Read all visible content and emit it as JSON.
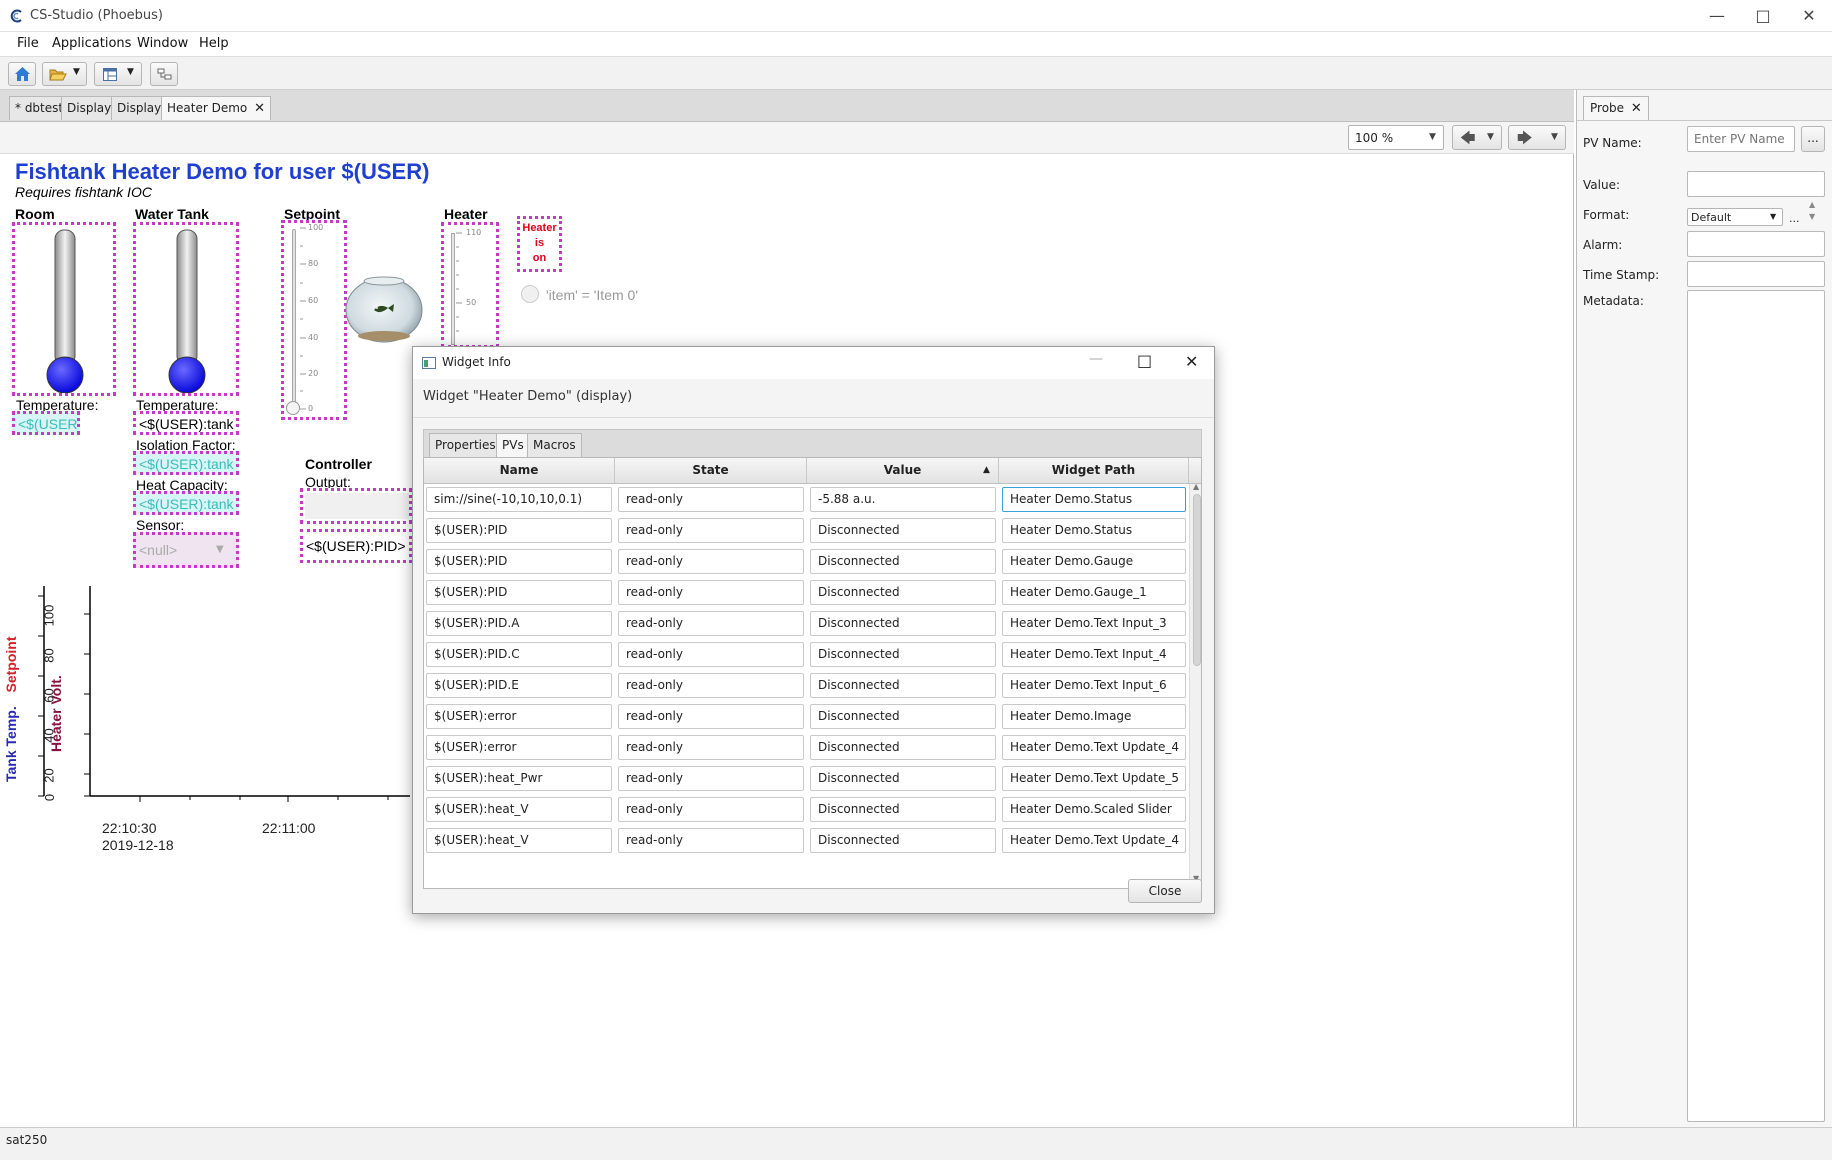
{
  "window": {
    "title": "CS-Studio (Phoebus)"
  },
  "menu": [
    "File",
    "Applications",
    "Window",
    "Help"
  ],
  "tabs": [
    {
      "label": "* dbtest",
      "active": false
    },
    {
      "label": "Display",
      "active": false
    },
    {
      "label": "Display",
      "active": false
    },
    {
      "label": "Heater Demo",
      "active": true,
      "closable": true
    }
  ],
  "zoom": {
    "value": "100 %"
  },
  "display": {
    "title": "Fishtank Heater Demo for user $(USER)",
    "subtitle": "Requires fishtank IOC",
    "room": {
      "heading": "Room",
      "temp_label": "Temperature:",
      "temp_value": "<$(USER)"
    },
    "tank": {
      "heading": "Water Tank",
      "temp_label": "Temperature:",
      "temp_value": "<$(USER):tank",
      "iso_label": "Isolation Factor:",
      "iso_value": "<$(USER):tank",
      "heat_label": "Heat Capacity:",
      "heat_value": "<$(USER):tank",
      "sensor_label": "Sensor:",
      "sensor_value": "<null>"
    },
    "setpoint": {
      "heading": "Setpoint",
      "ticks": [
        "100",
        "80",
        "60",
        "40",
        "20",
        "0"
      ],
      "level": 0
    },
    "heater": {
      "heading": "Heater",
      "ticks": [
        "110",
        "50"
      ]
    },
    "heater_led": {
      "line1": "Heater",
      "line2": "is",
      "line3": "on",
      "color": "#e0001a"
    },
    "radio_label": "'item' = 'Item 0'",
    "controller": {
      "heading": "Controller",
      "output_label": "Output:",
      "pid_value": "<$(USER):PID>"
    },
    "plot": {
      "y1_label": "Setpoint",
      "y2_label": "Tank Temp.",
      "y3_label": "Heater Volt.",
      "yticks": [
        "100",
        "80",
        "60",
        "40",
        "20",
        "0"
      ],
      "xticks": [
        "22:10:30",
        "22:11:00"
      ],
      "xdate": "2019-12-18",
      "setpoint_color": "#d0202a",
      "tank_color": "#2a2ab0",
      "heater_color": "#8a1040"
    }
  },
  "probe": {
    "tab": "Probe",
    "pv_label": "PV Name:",
    "pv_placeholder": "Enter PV Name",
    "browse_label": "...",
    "value_label": "Value:",
    "format_label": "Format:",
    "format_value": "Default",
    "format_extra": "...",
    "alarm_label": "Alarm:",
    "timestamp_label": "Time Stamp:",
    "metadata_label": "Metadata:"
  },
  "status": {
    "text": "sat250"
  },
  "dialog": {
    "title": "Widget Info",
    "heading": "Widget \"Heater Demo\" (display)",
    "tabs": [
      {
        "label": "Properties",
        "active": false
      },
      {
        "label": "PVs",
        "active": true
      },
      {
        "label": "Macros",
        "active": false
      }
    ],
    "columns": [
      "Name",
      "State",
      "Value",
      "Widget Path"
    ],
    "rows": [
      {
        "name": "sim://sine(-10,10,10,0.1)",
        "state": "read-only",
        "value": "-5.88 a.u.",
        "path": "Heater Demo.Status"
      },
      {
        "name": "$(USER):PID",
        "state": "read-only",
        "value": "Disconnected",
        "path": "Heater Demo.Status"
      },
      {
        "name": "$(USER):PID",
        "state": "read-only",
        "value": "Disconnected",
        "path": "Heater Demo.Gauge"
      },
      {
        "name": "$(USER):PID",
        "state": "read-only",
        "value": "Disconnected",
        "path": "Heater Demo.Gauge_1"
      },
      {
        "name": "$(USER):PID.A",
        "state": "read-only",
        "value": "Disconnected",
        "path": "Heater Demo.Text Input_3"
      },
      {
        "name": "$(USER):PID.C",
        "state": "read-only",
        "value": "Disconnected",
        "path": "Heater Demo.Text Input_4"
      },
      {
        "name": "$(USER):PID.E",
        "state": "read-only",
        "value": "Disconnected",
        "path": "Heater Demo.Text Input_6"
      },
      {
        "name": "$(USER):error",
        "state": "read-only",
        "value": "Disconnected",
        "path": "Heater Demo.Image"
      },
      {
        "name": "$(USER):error",
        "state": "read-only",
        "value": "Disconnected",
        "path": "Heater Demo.Text Update_4"
      },
      {
        "name": "$(USER):heat_Pwr",
        "state": "read-only",
        "value": "Disconnected",
        "path": "Heater Demo.Text Update_5"
      },
      {
        "name": "$(USER):heat_V",
        "state": "read-only",
        "value": "Disconnected",
        "path": "Heater Demo.Scaled Slider"
      },
      {
        "name": "$(USER):heat_V",
        "state": "read-only",
        "value": "Disconnected",
        "path": "Heater Demo.Text Update_4"
      }
    ],
    "close_label": "Close"
  }
}
